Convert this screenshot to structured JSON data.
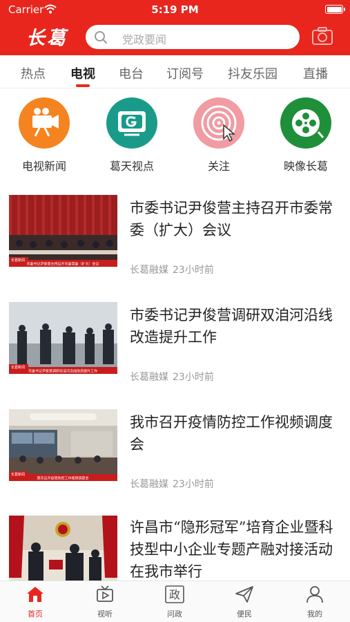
{
  "status": {
    "carrier": "Carrier",
    "time": "5:19 PM"
  },
  "header": {
    "logo": "长葛",
    "search_placeholder": "党政要闻"
  },
  "tabs": [
    "热点",
    "电视",
    "电台",
    "订阅号",
    "抖友乐园",
    "直播"
  ],
  "active_tab": "电视",
  "channels": [
    {
      "label": "电视新闻",
      "icon": "tv-camera-icon",
      "color": "#f5831f"
    },
    {
      "label": "葛天视点",
      "icon": "tv-screen-icon",
      "color": "#1a9b8a"
    },
    {
      "label": "关注",
      "icon": "target-cursor-icon",
      "color": "#f19ba3"
    },
    {
      "label": "映像长葛",
      "icon": "film-reel-icon",
      "color": "#1f8f3a"
    }
  ],
  "news": [
    {
      "title": "市委书记尹俊营主持召开市委常委（扩大）会议",
      "source": "长葛融媒",
      "time": "23小时前",
      "caption": "市委书记尹俊营主持召开市委常委（扩大）会议",
      "tag": "长葛新闻"
    },
    {
      "title": "市委书记尹俊营调研双洎河沿线改造提升工作",
      "source": "长葛融媒",
      "time": "23小时前",
      "caption": "市委书记尹俊营调研双洎河沿线改造提升工作",
      "tag": "长葛新闻"
    },
    {
      "title": "我市召开疫情防控工作视频调度会",
      "source": "长葛融媒",
      "time": "23小时前",
      "caption": "我市召开疫情防控工作视频调度会",
      "tag": "长葛新闻"
    },
    {
      "title": "许昌市“隐形冠军”培育企业暨科技型中小企业专题产融对接活动在我市举行",
      "source": "",
      "time": "",
      "caption": "",
      "tag": ""
    }
  ],
  "bottom_nav": [
    {
      "label": "首页",
      "icon": "home-icon"
    },
    {
      "label": "视听",
      "icon": "tv-play-icon"
    },
    {
      "label": "问政",
      "icon": "zheng-icon",
      "glyph": "政"
    },
    {
      "label": "便民",
      "icon": "send-icon"
    },
    {
      "label": "我的",
      "icon": "user-icon"
    }
  ],
  "colors": {
    "brand": "#e9261d"
  }
}
